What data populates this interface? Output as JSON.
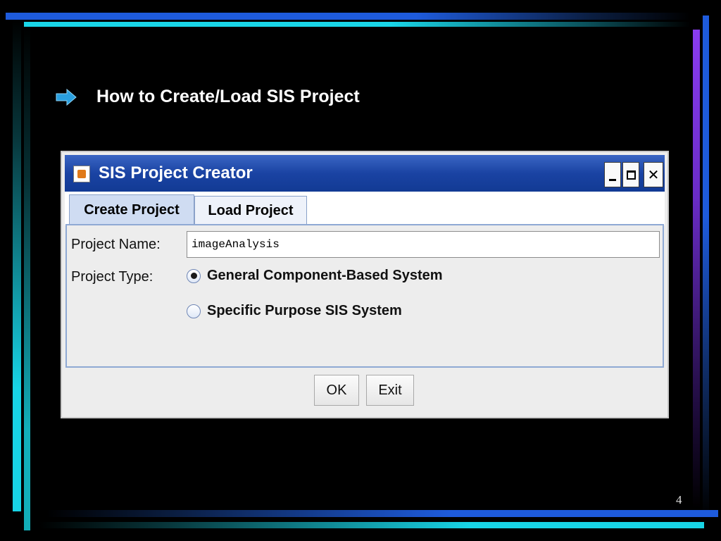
{
  "slide": {
    "heading": "How to Create/Load SIS Project",
    "page_number": "4"
  },
  "window": {
    "title": "SIS Project Creator",
    "tabs": [
      {
        "label": "Create Project",
        "active": true
      },
      {
        "label": "Load Project",
        "active": false
      }
    ],
    "form": {
      "project_name_label": "Project Name:",
      "project_name_value": "imageAnalysis",
      "project_type_label": "Project Type:",
      "options": [
        {
          "label": "General Component-Based System",
          "selected": true
        },
        {
          "label": "Specific Purpose SIS System",
          "selected": false
        }
      ]
    },
    "buttons": {
      "ok": "OK",
      "exit": "Exit"
    }
  },
  "colors": {
    "title_bar": "#1a43a3",
    "tab_active": "#cfdcf2",
    "panel_border": "#8fa9d4",
    "arrow": "#2aa0e0"
  },
  "icons": {
    "bullet": "arrow-right-icon",
    "app": "java-cup-icon",
    "minimize": "minimize-icon",
    "maximize": "maximize-icon",
    "close": "close-icon"
  }
}
